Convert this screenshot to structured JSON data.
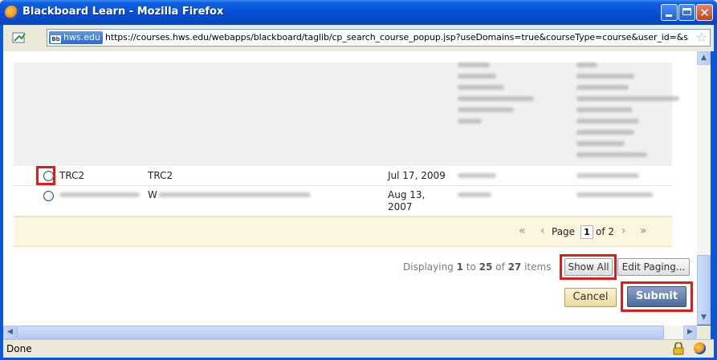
{
  "window": {
    "title": "Blackboard Learn - Mozilla Firefox",
    "min_glyph": "",
    "max_glyph": "",
    "close_glyph": "✕"
  },
  "urlbar": {
    "site_label": "hws.edu",
    "site_badge_icon": "Bb",
    "url": "https://courses.hws.edu/webapps/blackboard/taglib/cp_search_course_popup.jsp?useDomains=true&courseType=course&user_id=&s",
    "star": "☆"
  },
  "rows": [
    {
      "id": "TRC2",
      "name": "TRC2",
      "date": "Jul 17, 2009",
      "selected": false
    },
    {
      "id": "",
      "name": "W",
      "date_line1": "Aug 13,",
      "date_line2": "2007",
      "selected": false
    }
  ],
  "paging": {
    "first": "«",
    "prev": "‹",
    "page_label": "Page",
    "page_num": "1",
    "of_label": "of 2",
    "next": "›",
    "last": "»"
  },
  "display": {
    "prefix": "Displaying ",
    "from": "1",
    "to_label": " to ",
    "to": "25",
    "of_label": " of ",
    "total": "27",
    "suffix": " items"
  },
  "buttons": {
    "show_all": "Show All",
    "edit_paging": "Edit Paging...",
    "cancel": "Cancel",
    "submit": "Submit"
  },
  "scrollbar": {
    "up": "▲",
    "down": "▼",
    "left": "◀",
    "right": "▶"
  },
  "status": {
    "text": "Done"
  },
  "colors": {
    "highlight": "#e01b1b",
    "submit": "#4a6a9c",
    "titlebar": "#0551d8"
  }
}
